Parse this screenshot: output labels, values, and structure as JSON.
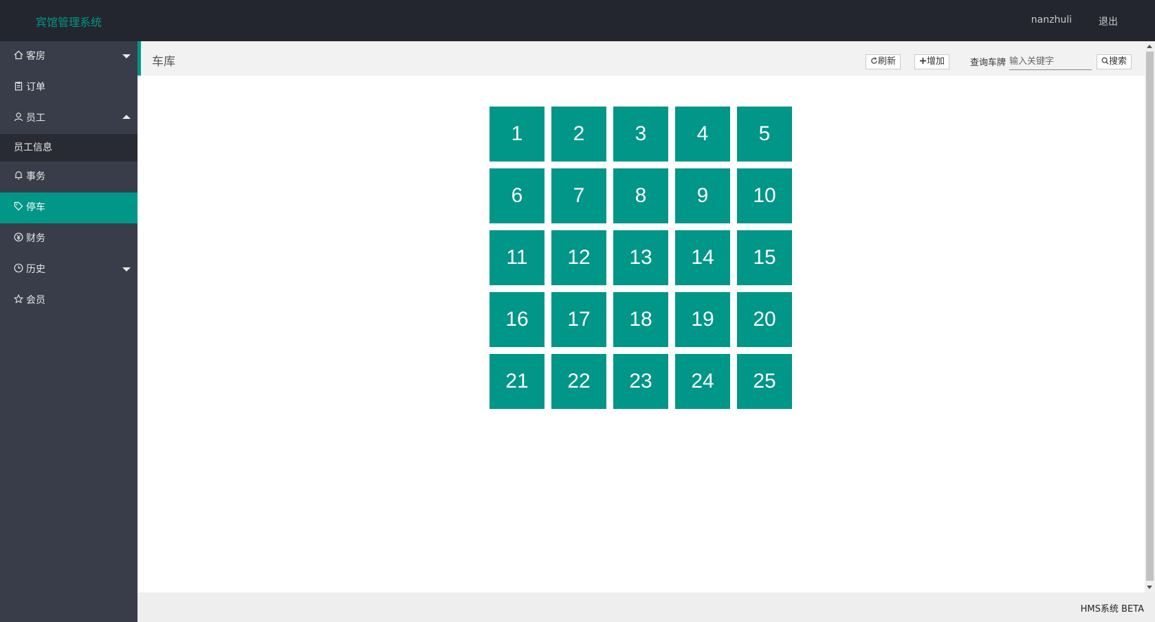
{
  "header": {
    "app_title": "宾馆管理系统",
    "username": "nanzhuli",
    "logout_label": "退出"
  },
  "sidebar": {
    "items": [
      {
        "label": "客房",
        "icon": "home-icon",
        "arrow": "down"
      },
      {
        "label": "订单",
        "icon": "clipboard-icon"
      },
      {
        "label": "员工",
        "icon": "user-icon",
        "arrow": "up"
      },
      {
        "label": "员工信息",
        "sub": true
      },
      {
        "label": "事务",
        "icon": "bell-icon"
      },
      {
        "label": "停车",
        "icon": "tag-icon",
        "active": true
      },
      {
        "label": "财务",
        "icon": "yen-icon"
      },
      {
        "label": "历史",
        "icon": "clock-icon",
        "arrow": "down"
      },
      {
        "label": "会员",
        "icon": "star-icon"
      }
    ]
  },
  "toolbar": {
    "title": "车库",
    "refresh_label": "刷新",
    "add_label": "增加",
    "search_label": "查询车牌",
    "search_placeholder": "输入关键字",
    "search_button_label": "搜索"
  },
  "parking_slots": [
    "1",
    "2",
    "3",
    "4",
    "5",
    "6",
    "7",
    "8",
    "9",
    "10",
    "11",
    "12",
    "13",
    "14",
    "15",
    "16",
    "17",
    "18",
    "19",
    "20",
    "21",
    "22",
    "23",
    "24",
    "25"
  ],
  "footer": {
    "text": "HMS系统 BETA"
  },
  "colors": {
    "accent": "#009688",
    "header_bg": "#23262e",
    "sidebar_bg": "#393d49",
    "sub_bg": "#282b33"
  }
}
